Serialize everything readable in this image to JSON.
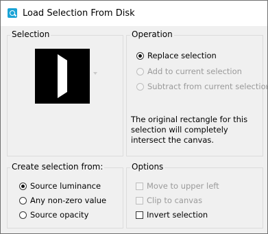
{
  "window": {
    "title": "Load Selection From Disk",
    "icon": "app-selection-icon"
  },
  "selection": {
    "group_title": "Selection"
  },
  "operation": {
    "group_title": "Operation",
    "options": [
      {
        "label": "Replace selection",
        "selected": true,
        "enabled": true
      },
      {
        "label": "Add to current selection",
        "selected": false,
        "enabled": false
      },
      {
        "label": "Subtract from current selection",
        "selected": false,
        "enabled": false
      }
    ],
    "description": "The original rectangle for this selection will completely intersect the canvas."
  },
  "create_from": {
    "group_title": "Create selection from:",
    "options": [
      {
        "label": "Source luminance",
        "selected": true
      },
      {
        "label": "Any non-zero value",
        "selected": false
      },
      {
        "label": "Source opacity",
        "selected": false
      }
    ]
  },
  "options": {
    "group_title": "Options",
    "items": [
      {
        "label": "Move to upper left",
        "checked": false,
        "enabled": false
      },
      {
        "label": "Clip to canvas",
        "checked": false,
        "enabled": false
      },
      {
        "label": "Invert selection",
        "checked": false,
        "enabled": true
      }
    ]
  }
}
